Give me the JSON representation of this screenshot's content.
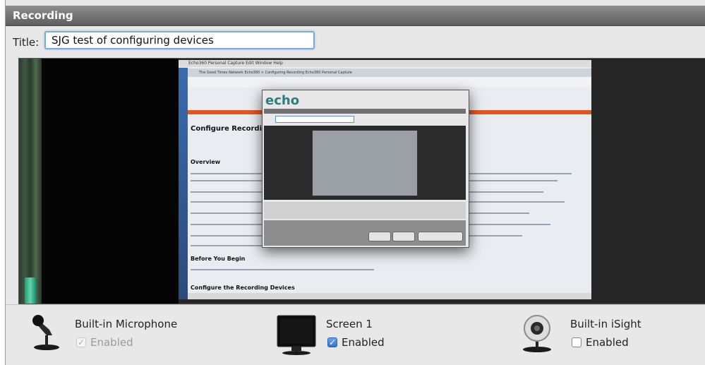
{
  "header": {
    "title": "Recording"
  },
  "title_field": {
    "label": "Title:",
    "value": "SJG test of configuring devices"
  },
  "preview": {
    "menubar_text": "Echo360 Personal Capture   Edit   Window   Help",
    "tabs_text": "The Good Times Network   Echo360 > Configuring Recording   Echo360 Personal Capture",
    "page_heading": "Configure Recording Devices",
    "overview_heading": "Overview",
    "before_heading": "Before You Begin",
    "configure_heading": "Configure the Recording Devices",
    "dialog_logo": "echo"
  },
  "devices": [
    {
      "name": "Built-in Microphone",
      "enabled_label": "Enabled",
      "enabled": true,
      "dimmed": true,
      "icon": "microphone-icon"
    },
    {
      "name": "Screen 1",
      "enabled_label": "Enabled",
      "enabled": true,
      "dimmed": false,
      "icon": "monitor-icon"
    },
    {
      "name": "Built-in iSight",
      "enabled_label": "Enabled",
      "enabled": false,
      "dimmed": false,
      "icon": "webcam-icon"
    }
  ],
  "colors": {
    "header": "#6f6f6f",
    "accent": "#2e72d2",
    "orange": "#e3561f"
  }
}
